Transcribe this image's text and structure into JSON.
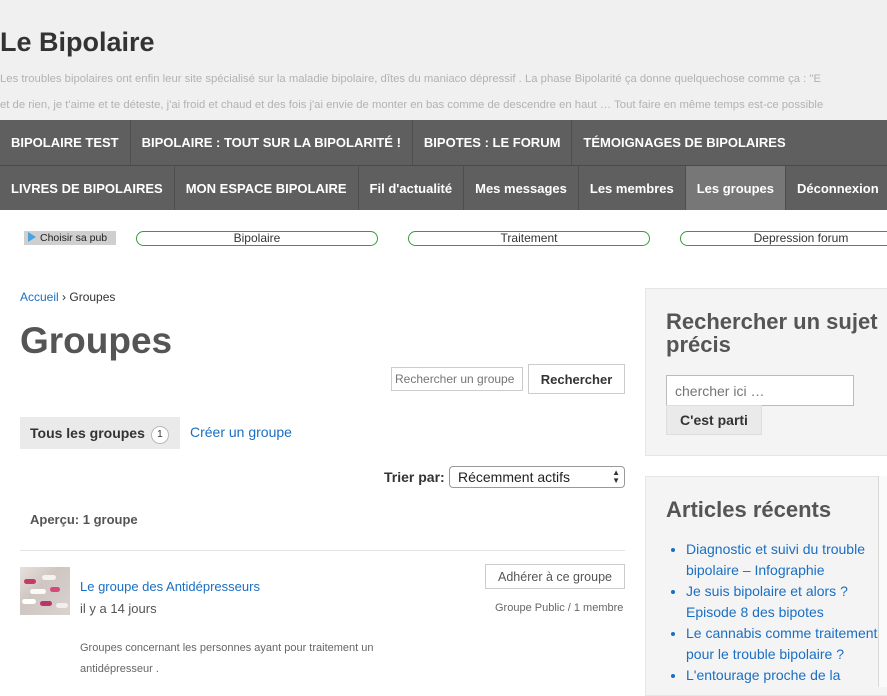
{
  "site": {
    "title": "Le Bipolaire",
    "description_line1": "Les troubles bipolaires ont enfin leur site spécialisé sur la maladie bipolaire, dîtes du maniaco dépressif . La phase Bipolarité ça donne quelquechose comme ça : \"E",
    "description_line2": "et de rien, je t'aime et te déteste, j'ai froid et chaud et des fois j'ai envie de monter en bas comme de descendre en haut … Tout faire en même temps est-ce possible"
  },
  "nav": {
    "row1": [
      "BIPOLAIRE TEST",
      "BIPOLAIRE : TOUT SUR LA BIPOLARITÉ !",
      "BIPOTES : LE FORUM",
      "TÉMOIGNAGES DE BIPOLAIRES"
    ],
    "row2": [
      "LIVRES DE BIPOLAIRES",
      "MON ESPACE BIPOLAIRE",
      "Fil d'actualité",
      "Mes messages",
      "Les membres",
      "Les groupes",
      "Déconnexion"
    ],
    "active": "Les groupes"
  },
  "ads": {
    "choice_label": "Choisir sa pub",
    "links": [
      "Bipolaire",
      "Traitement",
      "Depression forum"
    ]
  },
  "breadcrumb": {
    "home": "Accueil",
    "separator": "›",
    "current": "Groupes"
  },
  "page": {
    "title": "Groupes",
    "search_placeholder": "Rechercher un groupe",
    "search_button": "Rechercher",
    "tab_all_label": "Tous les groupes",
    "tab_all_count": "1",
    "tab_create_label": "Créer un groupe",
    "sort_label": "Trier par:",
    "sort_value": "Récemment actifs",
    "overview": "Aperçu: 1 groupe"
  },
  "groups": [
    {
      "name": "Le groupe des Antidépresseurs",
      "time": "il y a 14 jours",
      "description": "Groupes concernant les personnes ayant pour traitement un antidépresseur .",
      "join_label": "Adhérer à ce groupe",
      "meta": "Groupe Public / 1 membre"
    }
  ],
  "sidebar": {
    "search_title": "Rechercher un sujet précis",
    "search_placeholder": "chercher ici …",
    "search_button": "C'est parti",
    "recent_title": "Articles récents",
    "recent_items": [
      "Diagnostic et suivi du trouble bipolaire – Infographie",
      "Je suis bipolaire et alors ? Episode 8 des bipotes",
      "Le cannabis comme traitement pour le trouble bipolaire ?",
      "L'entourage proche de la"
    ]
  },
  "colors": {
    "link": "#1a6fc4",
    "nav_bg": "#5f5f5f",
    "nav_active": "#777777",
    "header_bg": "#f0f0f0",
    "ad_border": "#3a9a3a"
  },
  "icons": [
    "ad-choices-icon",
    "dropdown-arrows-icon",
    "group-avatar-image"
  ]
}
